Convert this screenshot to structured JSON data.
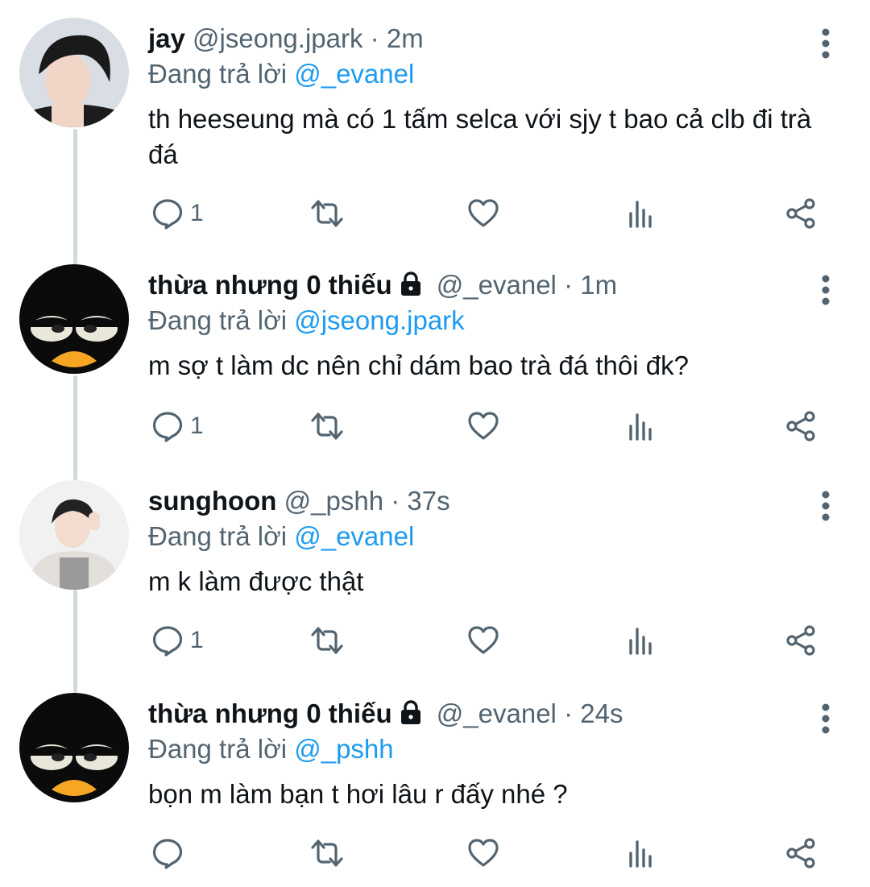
{
  "tweets": [
    {
      "name": "jay",
      "handle": "@jseong.jpark",
      "separator": "·",
      "time": "2m",
      "replying_prefix": "Đang trả lời",
      "replying_to": "@_evanel",
      "text": "th heeseung mà có 1 tấm selca với sjy t bao cả clb đi trà đá",
      "reply_count": "1",
      "locked": false
    },
    {
      "name": "thừa nhưng 0 thiếu",
      "handle": "@_evanel",
      "separator": "·",
      "time": "1m",
      "replying_prefix": "Đang trả lời",
      "replying_to": "@jseong.jpark",
      "text": "m sợ t làm dc nên chỉ dám bao trà đá thôi đk?",
      "reply_count": "1",
      "locked": true
    },
    {
      "name": "sunghoon",
      "handle": "@_pshh",
      "separator": "·",
      "time": "37s",
      "replying_prefix": "Đang trả lời",
      "replying_to": "@_evanel",
      "text": "m k làm được thật",
      "reply_count": "1",
      "locked": false
    },
    {
      "name": "thừa nhưng 0 thiếu",
      "handle": "@_evanel",
      "separator": "·",
      "time": "24s",
      "replying_prefix": "Đang trả lời",
      "replying_to": "@_pshh",
      "text": "bọn m làm bạn t hơi lâu r đấy nhé ?",
      "reply_count": "",
      "locked": true
    }
  ],
  "icons": {
    "reply": "reply-icon",
    "retweet": "retweet-icon",
    "like": "heart-icon",
    "views": "analytics-icon",
    "share": "share-icon",
    "more": "more-vertical-icon",
    "lock": "lock-icon"
  },
  "colors": {
    "text": "#0f1419",
    "secondary": "#536471",
    "link": "#1d9bf0",
    "thread_line": "#cfd9de"
  }
}
